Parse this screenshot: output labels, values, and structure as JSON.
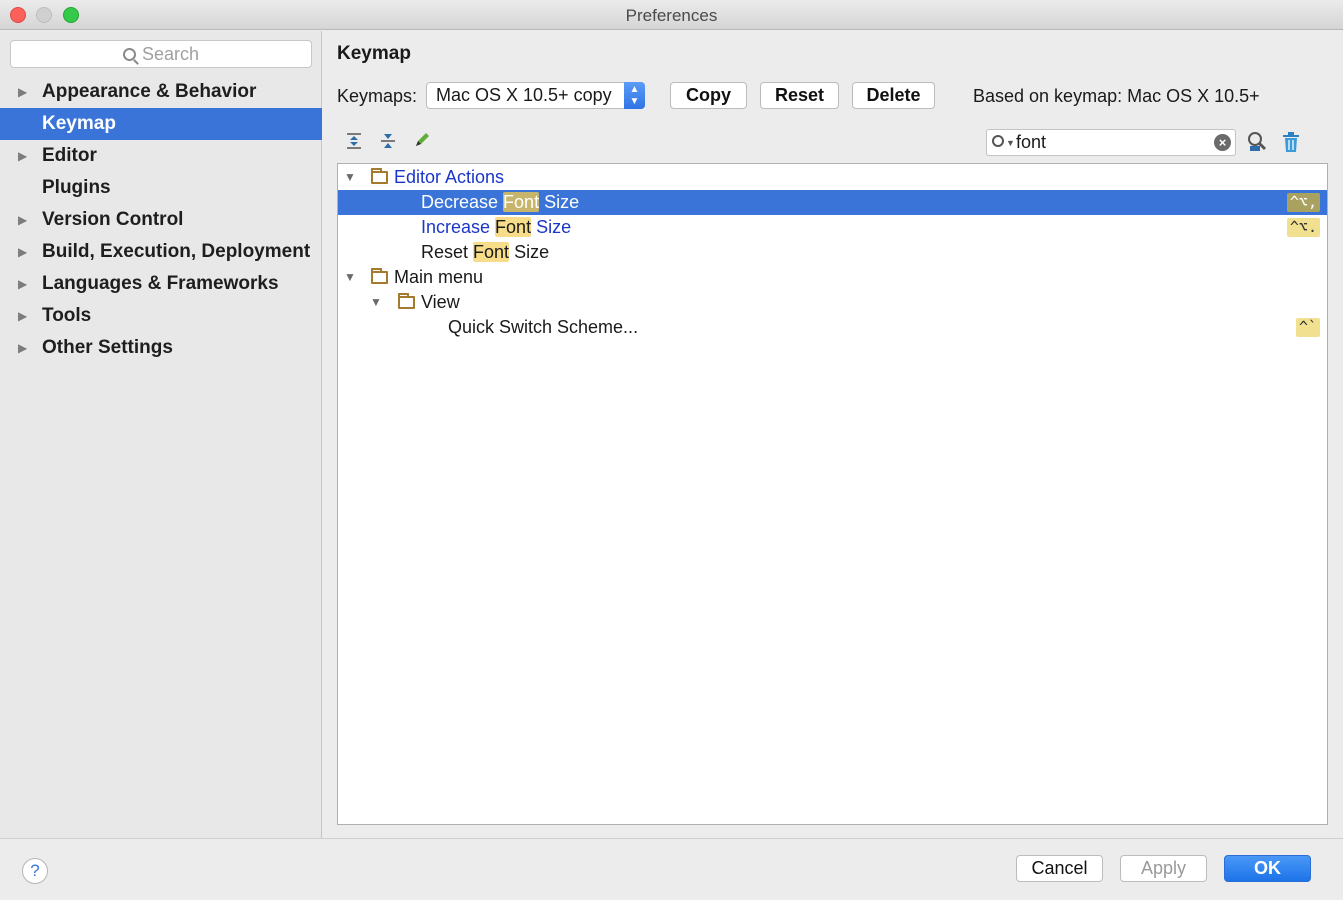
{
  "window": {
    "title": "Preferences"
  },
  "sidebar": {
    "search_placeholder": "Search",
    "items": [
      {
        "label": "Appearance & Behavior",
        "expandable": true,
        "selected": false
      },
      {
        "label": "Keymap",
        "expandable": false,
        "selected": true
      },
      {
        "label": "Editor",
        "expandable": true,
        "selected": false
      },
      {
        "label": "Plugins",
        "expandable": false,
        "selected": false
      },
      {
        "label": "Version Control",
        "expandable": true,
        "selected": false
      },
      {
        "label": "Build, Execution, Deployment",
        "expandable": true,
        "selected": false
      },
      {
        "label": "Languages & Frameworks",
        "expandable": true,
        "selected": false
      },
      {
        "label": "Tools",
        "expandable": true,
        "selected": false
      },
      {
        "label": "Other Settings",
        "expandable": true,
        "selected": false
      }
    ]
  },
  "main": {
    "heading": "Keymap",
    "keymaps_label": "Keymaps:",
    "keymap_selected": "Mac OS X 10.5+ copy",
    "buttons": {
      "copy": "Copy",
      "reset": "Reset",
      "delete": "Delete"
    },
    "based_on": "Based on keymap: Mac OS X 10.5+",
    "filter_value": "font",
    "tree": {
      "editor_actions": "Editor Actions",
      "decrease": {
        "before": "Decrease ",
        "match": "Font",
        "after": " Size",
        "shortcut": "^⌥,"
      },
      "increase": {
        "before": "Increase ",
        "match": "Font",
        "after": " Size",
        "shortcut": "^⌥."
      },
      "reset": {
        "before": "Reset ",
        "match": "Font",
        "after": " Size"
      },
      "main_menu": "Main menu",
      "view": "View",
      "quick_switch": {
        "label": "Quick Switch Scheme...",
        "shortcut": "^`"
      }
    }
  },
  "footer": {
    "help": "?",
    "cancel": "Cancel",
    "apply": "Apply",
    "ok": "OK"
  },
  "colors": {
    "selection": "#3a74d8",
    "highlight": "#f7dc8a",
    "link_blue": "#1b36c8"
  }
}
